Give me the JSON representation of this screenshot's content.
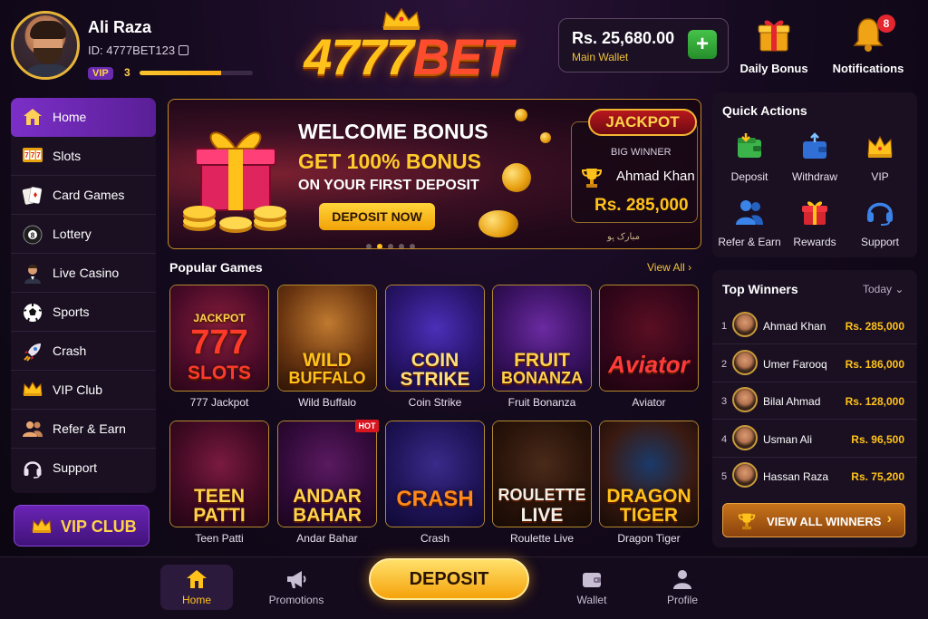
{
  "profile": {
    "name": "Ali Raza",
    "id": "ID: 4777BET123",
    "vip_badge": "VIP",
    "vip_level": "3",
    "vip_progress": 0.72
  },
  "logo": {
    "part1": "4777",
    "part2": "BET"
  },
  "wallet": {
    "amount": "Rs. 25,680.00",
    "label": "Main Wallet",
    "add_label": "+"
  },
  "header": {
    "daily_bonus": "Daily Bonus",
    "notifications": "Notifications",
    "notification_count": "8"
  },
  "sidebar": {
    "items": [
      {
        "label": "Home",
        "icon": "home-icon",
        "active": true
      },
      {
        "label": "Slots",
        "icon": "slots-icon"
      },
      {
        "label": "Card Games",
        "icon": "cards-icon"
      },
      {
        "label": "Lottery",
        "icon": "lottery-ball-icon"
      },
      {
        "label": "Live Casino",
        "icon": "dealer-icon"
      },
      {
        "label": "Sports",
        "icon": "soccer-ball-icon"
      },
      {
        "label": "Crash",
        "icon": "rocket-icon"
      },
      {
        "label": "VIP Club",
        "icon": "crown-icon"
      },
      {
        "label": "Refer & Earn",
        "icon": "users-icon"
      },
      {
        "label": "Support",
        "icon": "headset-icon"
      }
    ],
    "vip_club_button": "VIP CLUB"
  },
  "banner": {
    "title": "WELCOME BONUS",
    "subtitle": "GET 100% BONUS",
    "subtitle2": "ON YOUR FIRST DEPOSIT",
    "cta": "DEPOSIT NOW",
    "slide_count": 5,
    "active_slide": 2,
    "jackpot": {
      "tag": "JACKPOT",
      "label": "BIG WINNER",
      "name": "Ahmad Khan",
      "amount": "Rs. 285,000",
      "footer": "ﻣﺒﺎﺭﮎ ﮨﻮ"
    }
  },
  "popular_games": {
    "title": "Popular Games",
    "view_all": "View All",
    "games": [
      {
        "label": "777 Jackpot",
        "art_lines": [
          "777",
          "SLOTS"
        ],
        "art_top": "JACKPOT"
      },
      {
        "label": "Wild Buffalo",
        "art_lines": [
          "WILD",
          "BUFFALO"
        ]
      },
      {
        "label": "Coin Strike",
        "art_lines": [
          "COIN",
          "STRIKE"
        ]
      },
      {
        "label": "Fruit Bonanza",
        "art_lines": [
          "FRUIT",
          "BONANZA"
        ]
      },
      {
        "label": "Aviator",
        "art_lines": [
          "Aviator"
        ]
      },
      {
        "label": "Teen Patti",
        "art_lines": [
          "TEEN",
          "PATTI"
        ]
      },
      {
        "label": "Andar Bahar",
        "art_lines": [
          "ANDAR",
          "BAHAR"
        ],
        "badge": "HOT"
      },
      {
        "label": "Crash",
        "art_lines": [
          "CRASH"
        ]
      },
      {
        "label": "Roulette Live",
        "art_lines": [
          "ROULETTE",
          "LIVE"
        ]
      },
      {
        "label": "Dragon Tiger",
        "art_lines": [
          "DRAGON",
          "TIGER"
        ]
      }
    ]
  },
  "quick_actions": {
    "title": "Quick Actions",
    "items": [
      {
        "label": "Deposit",
        "icon": "wallet-deposit-icon"
      },
      {
        "label": "Withdraw",
        "icon": "withdraw-icon"
      },
      {
        "label": "VIP",
        "icon": "crown-icon"
      },
      {
        "label": "Refer & Earn",
        "icon": "users-icon"
      },
      {
        "label": "Rewards",
        "icon": "gift-icon"
      },
      {
        "label": "Support",
        "icon": "headset-icon"
      }
    ]
  },
  "top_winners": {
    "title": "Top Winners",
    "filter": "Today",
    "rows": [
      {
        "rank": "1",
        "name": "Ahmad Khan",
        "amount": "Rs. 285,000"
      },
      {
        "rank": "2",
        "name": "Umer Farooq",
        "amount": "Rs. 186,000"
      },
      {
        "rank": "3",
        "name": "Bilal Ahmad",
        "amount": "Rs. 128,000"
      },
      {
        "rank": "4",
        "name": "Usman Ali",
        "amount": "Rs. 96,500"
      },
      {
        "rank": "5",
        "name": "Hassan Raza",
        "amount": "Rs. 75,200"
      }
    ],
    "view_all": "VIEW ALL WINNERS"
  },
  "bottom_nav": {
    "home": "Home",
    "promotions": "Promotions",
    "deposit": "DEPOSIT",
    "wallet": "Wallet",
    "profile": "Profile"
  },
  "colors": {
    "accent_gold": "#ffc21a",
    "accent_purple": "#7b2fc7",
    "background": "#150a1f",
    "success_green": "#46c24a",
    "alert_red": "#e3262f"
  }
}
